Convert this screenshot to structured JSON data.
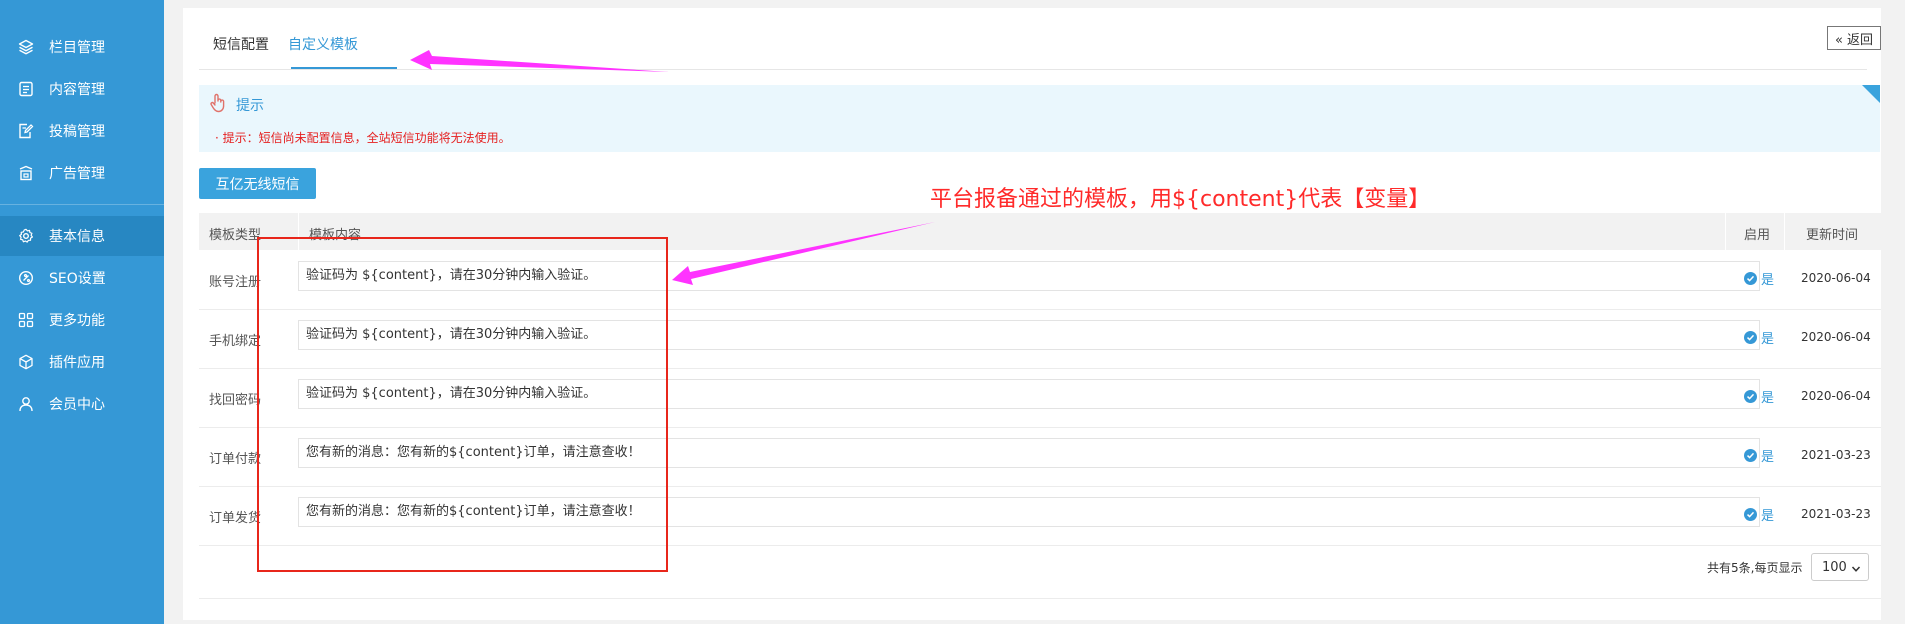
{
  "sidebar": {
    "items": [
      {
        "label": "栏目管理",
        "icon": "layers-icon"
      },
      {
        "label": "内容管理",
        "icon": "document-icon"
      },
      {
        "label": "投稿管理",
        "icon": "edit-document-icon"
      },
      {
        "label": "广告管理",
        "icon": "ad-icon"
      },
      {
        "label": "基本信息",
        "icon": "gear-icon",
        "active": true
      },
      {
        "label": "SEO设置",
        "icon": "seo-icon"
      },
      {
        "label": "更多功能",
        "icon": "grid-icon"
      },
      {
        "label": "插件应用",
        "icon": "cube-icon"
      },
      {
        "label": "会员中心",
        "icon": "user-icon"
      }
    ]
  },
  "tabs": [
    {
      "label": "短信配置"
    },
    {
      "label": "自定义模板",
      "active": true
    }
  ],
  "back_button": "« 返回",
  "tip": {
    "title": "提示",
    "message": "· 提示：短信尚未配置信息，全站短信功能将无法使用。"
  },
  "provider_button": "互亿无线短信",
  "table": {
    "headers": {
      "type": "模板类型",
      "content": "模板内容",
      "enabled": "启用",
      "updated": "更新时间"
    },
    "rows": [
      {
        "type": "账号注册",
        "content": "验证码为 ${content}，请在30分钟内输入验证。",
        "enabled": "是",
        "date": "2020-06-04"
      },
      {
        "type": "手机绑定",
        "content": "验证码为 ${content}，请在30分钟内输入验证。",
        "enabled": "是",
        "date": "2020-06-04"
      },
      {
        "type": "找回密码",
        "content": "验证码为 ${content}，请在30分钟内输入验证。",
        "enabled": "是",
        "date": "2020-06-04"
      },
      {
        "type": "订单付款",
        "content": "您有新的消息：您有新的${content}订单，请注意查收！",
        "enabled": "是",
        "date": "2021-03-23"
      },
      {
        "type": "订单发货",
        "content": "您有新的消息：您有新的${content}订单，请注意查收！",
        "enabled": "是",
        "date": "2021-03-23"
      }
    ]
  },
  "pager": {
    "summary": "共有5条,每页显示",
    "per_page": "100"
  },
  "annotation": {
    "text": "平台报备通过的模板，用${content}代表【变量】",
    "color": "#ff2a2a"
  },
  "colors": {
    "sidebar": "#3598d6",
    "accent": "#3598d6",
    "annotation_arrow": "#ff33ff",
    "annotation_box": "#e8261b"
  }
}
